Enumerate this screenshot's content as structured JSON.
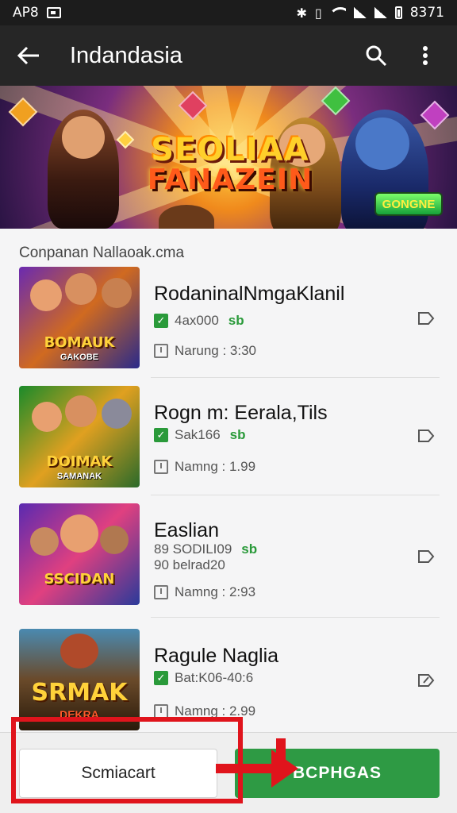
{
  "status_bar": {
    "left_text": "AP8",
    "time": "8371"
  },
  "app_bar": {
    "title": "Indandasia"
  },
  "banner": {
    "line1": "SEOLIAA",
    "line2": "FANAZEIN",
    "badge": "GONGNE"
  },
  "section": {
    "title": "Conpanan Nallaoak.cma"
  },
  "games": [
    {
      "name": "RodaninalNmgaKlanil",
      "meta1": "4ax000",
      "meta1_sub": "sb",
      "meta2": "Narung : 3:30",
      "thumb_label": "BOMAUK",
      "thumb_sub": "GAKOBE"
    },
    {
      "name": "Rogn m: Eerala,Tils",
      "meta1": "Sak166",
      "meta1_sub": "sb",
      "meta2": "Namng : 1.99",
      "thumb_label": "DOIMAK",
      "thumb_sub": "SAMANAK"
    },
    {
      "name": "Easlian",
      "meta1": "89 SODILI09",
      "meta1_sub": "sb",
      "meta1_line2": "90 belrad20",
      "meta2": "Namng : 2:93",
      "thumb_label": "SSCIDAN",
      "thumb_sub": ""
    },
    {
      "name": "Ragule Naglia",
      "meta1": "Bat:K06-40:6",
      "meta1_sub": "",
      "meta2": "Namng : 2.99",
      "thumb_label": "SRMAK",
      "thumb_sub": "DEKRA"
    }
  ],
  "bottom": {
    "secondary_label": "Scmiacart",
    "primary_label": "BCPHGAS"
  },
  "colors": {
    "accent_green": "#2e9a44",
    "annotation_red": "#e0141c",
    "app_bar": "#262626"
  }
}
